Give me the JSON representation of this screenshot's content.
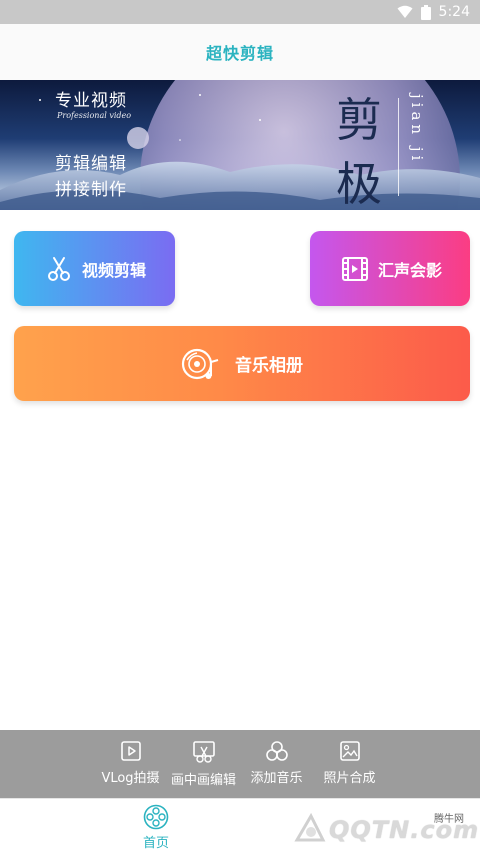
{
  "status_bar": {
    "time": "5:24"
  },
  "app_bar": {
    "title": "超快剪辑"
  },
  "banner": {
    "line1": "专业视频",
    "line2": "Professional video",
    "line3": "剪辑编辑",
    "line4": "拼接制作",
    "big1": "剪",
    "big2": "极",
    "vertical": "jian ji"
  },
  "cards": {
    "video_edit": {
      "label": "视频剪辑",
      "icon": "scissors-icon"
    },
    "voice_shadow": {
      "label": "汇声会影",
      "icon": "film-icon"
    },
    "music_album": {
      "label": "音乐相册",
      "icon": "music-disc-icon"
    }
  },
  "toolbar": {
    "items": [
      {
        "label": "VLog拍摄",
        "icon": "play-square-icon"
      },
      {
        "label": "画中画编辑",
        "icon": "pip-edit-icon"
      },
      {
        "label": "添加音乐",
        "icon": "circles-icon"
      },
      {
        "label": "照片合成",
        "icon": "image-icon"
      }
    ]
  },
  "bottom_nav": {
    "home_label": "首页",
    "home_icon": "film-reel-icon"
  },
  "watermark": {
    "main": "QQTN.com",
    "small": "腾牛网"
  },
  "colors": {
    "accent": "#2bb3c0",
    "video_card": [
      "#3fb7f0",
      "#7a6cf2"
    ],
    "voice_card": [
      "#c457ee",
      "#fb3d83"
    ],
    "music_card": [
      "#ffa24c",
      "#fc5b4a"
    ],
    "toolbar_bg": "#9c9c9c"
  }
}
